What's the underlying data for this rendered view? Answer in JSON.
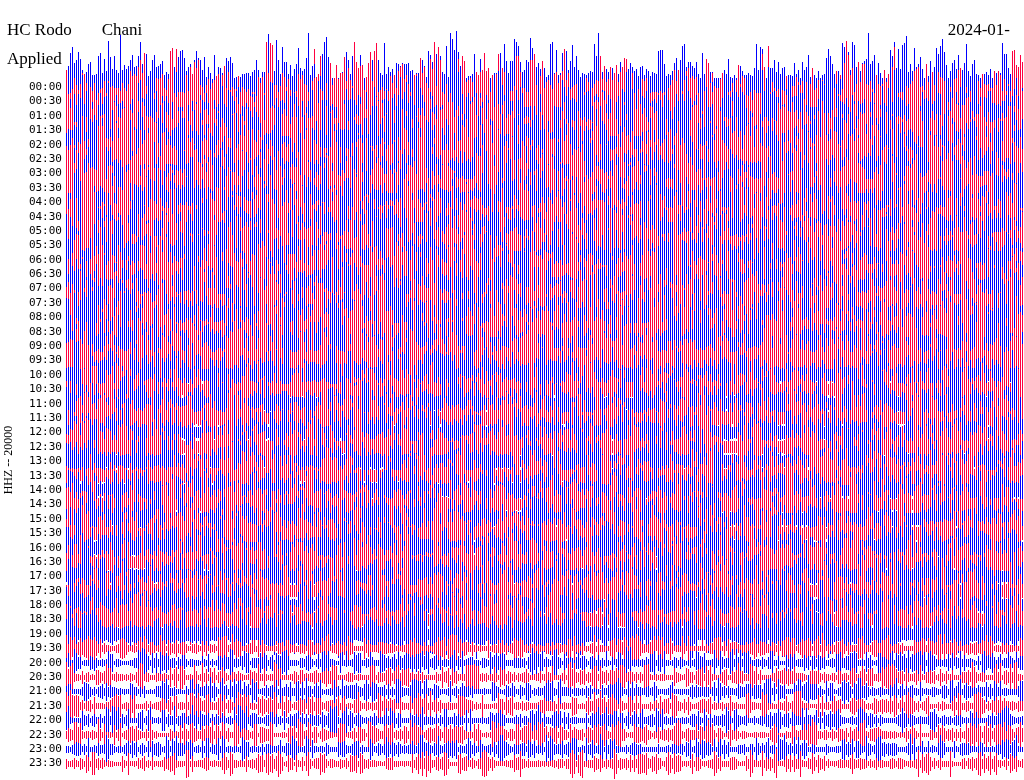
{
  "header": {
    "title_fragments": [
      "HC Rodo",
      "Chani"
    ],
    "subtitle": "Applied",
    "date": "2024-01-"
  },
  "axis": {
    "channel_label": "HHZ -- 20000",
    "times": [
      "00:00",
      "00:30",
      "01:00",
      "01:30",
      "02:00",
      "02:30",
      "03:00",
      "03:30",
      "04:00",
      "04:30",
      "05:00",
      "05:30",
      "06:00",
      "06:30",
      "07:00",
      "07:30",
      "08:00",
      "08:30",
      "09:00",
      "09:30",
      "10:00",
      "10:30",
      "11:00",
      "11:30",
      "12:00",
      "12:30",
      "13:00",
      "13:30",
      "14:00",
      "14:30",
      "15:00",
      "15:30",
      "16:00",
      "16:30",
      "17:00",
      "17:30",
      "18:00",
      "18:30",
      "19:00",
      "19:30",
      "20:00",
      "20:30",
      "21:00",
      "21:30",
      "22:00",
      "22:30",
      "23:00",
      "23:30"
    ]
  }
}
